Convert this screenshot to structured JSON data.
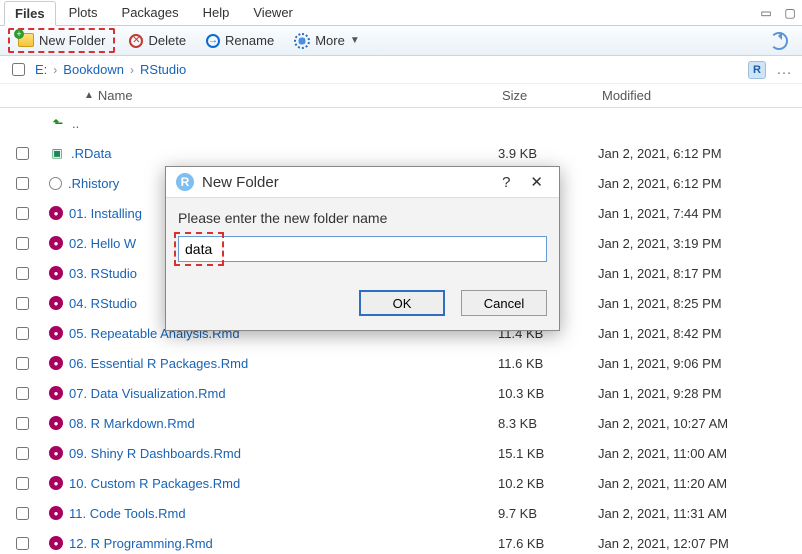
{
  "tabs": {
    "items": [
      "Files",
      "Plots",
      "Packages",
      "Help",
      "Viewer"
    ],
    "active": "Files"
  },
  "toolbar": {
    "new_folder": "New Folder",
    "delete": "Delete",
    "rename": "Rename",
    "more": "More"
  },
  "breadcrumb": {
    "root": "E:",
    "parts": [
      "Bookdown",
      "RStudio"
    ]
  },
  "columns": {
    "name": "Name",
    "size": "Size",
    "modified": "Modified"
  },
  "up_label": "..",
  "files": [
    {
      "icon": "rdata",
      "name": ".RData",
      "size": "3.9 KB",
      "modified": "Jan 2, 2021, 6:12 PM"
    },
    {
      "icon": "rhist",
      "name": ".Rhistory",
      "size": "",
      "modified": "Jan 2, 2021, 6:12 PM"
    },
    {
      "icon": "rmd",
      "name": "01. Installing",
      "size": "",
      "modified": "Jan 1, 2021, 7:44 PM"
    },
    {
      "icon": "rmd",
      "name": "02. Hello W",
      "size": "",
      "modified": "Jan 2, 2021, 3:19 PM"
    },
    {
      "icon": "rmd",
      "name": "03. RStudio",
      "size": "",
      "modified": "Jan 1, 2021, 8:17 PM"
    },
    {
      "icon": "rmd",
      "name": "04. RStudio",
      "size": "",
      "modified": "Jan 1, 2021, 8:25 PM"
    },
    {
      "icon": "rmd",
      "name": "05. Repeatable Analysis.Rmd",
      "size": "11.4 KB",
      "modified": "Jan 1, 2021, 8:42 PM"
    },
    {
      "icon": "rmd",
      "name": "06. Essential R Packages.Rmd",
      "size": "11.6 KB",
      "modified": "Jan 1, 2021, 9:06 PM"
    },
    {
      "icon": "rmd",
      "name": "07. Data Visualization.Rmd",
      "size": "10.3 KB",
      "modified": "Jan 1, 2021, 9:28 PM"
    },
    {
      "icon": "rmd",
      "name": "08. R Markdown.Rmd",
      "size": "8.3 KB",
      "modified": "Jan 2, 2021, 10:27 AM"
    },
    {
      "icon": "rmd",
      "name": "09. Shiny R Dashboards.Rmd",
      "size": "15.1 KB",
      "modified": "Jan 2, 2021, 11:00 AM"
    },
    {
      "icon": "rmd",
      "name": "10. Custom R Packages.Rmd",
      "size": "10.2 KB",
      "modified": "Jan 2, 2021, 11:20 AM"
    },
    {
      "icon": "rmd",
      "name": "11. Code Tools.Rmd",
      "size": "9.7 KB",
      "modified": "Jan 2, 2021, 11:31 AM"
    },
    {
      "icon": "rmd",
      "name": "12. R Programming.Rmd",
      "size": "17.6 KB",
      "modified": "Jan 2, 2021, 12:07 PM"
    }
  ],
  "dialog": {
    "title": "New Folder",
    "prompt": "Please enter the new folder name",
    "value": "data",
    "ok": "OK",
    "cancel": "Cancel"
  }
}
